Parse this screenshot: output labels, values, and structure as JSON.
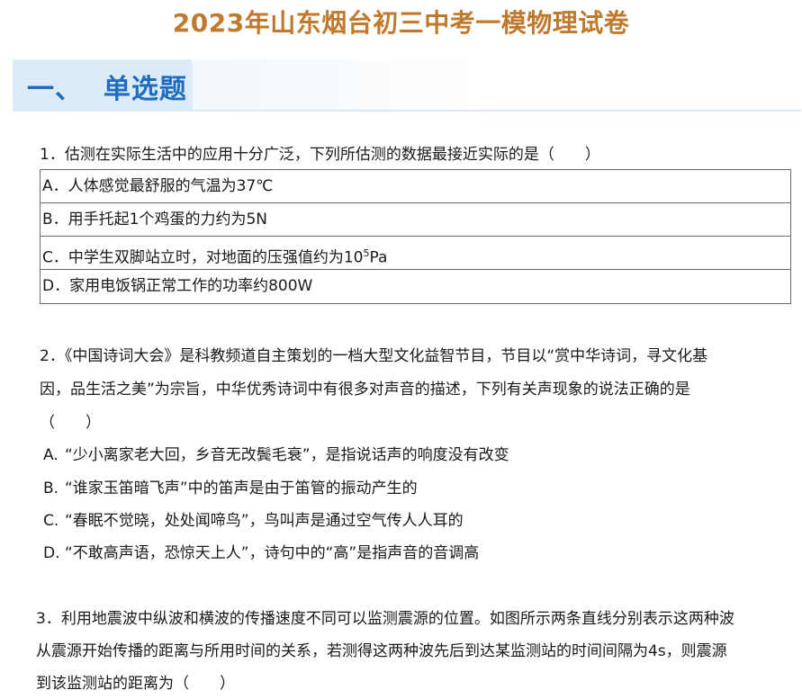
{
  "header": {
    "title": "2023年山东烟台初三中考一模物理试卷"
  },
  "section": {
    "title": "一、  单选题"
  },
  "q1": {
    "stem": "1．估测在实际生活中的应用十分广泛，下列所估测的数据最接近实际的是（　　）",
    "options": [
      {
        "text": "A．人体感觉最舒服的气温为37℃"
      },
      {
        "text": "B．用手托起1个鸡蛋的力约为5N"
      },
      {
        "prefix": "C．中学生双脚站立时，对地面的压强值约为10",
        "sup": "5",
        "suffix": "Pa"
      },
      {
        "text": "D．家用电饭锅正常工作的功率约800W"
      }
    ]
  },
  "q2": {
    "lines": [
      "2．《中国诗词大会》是科教频道自主策划的一档大型文化益智节目，节目以“赏中华诗词，寻文化基",
      "因，品生活之美”为宗旨，中华优秀诗词中有很多对声音的描述，下列有关声现象的说法正确的是",
      "（　　）"
    ],
    "options": [
      {
        "letter": "A.",
        "text": "“少小离家老大回，乡音无改鬓毛衰”，是指说话声的响度没有改变"
      },
      {
        "letter": "B.",
        "text": "“谁家玉笛暗飞声”中的笛声是由于笛管的振动产生的"
      },
      {
        "letter": "C.",
        "text": "“春眠不觉晓，处处闻啼鸟”，鸟叫声是通过空气传人人耳的"
      },
      {
        "letter": "D.",
        "text": "“不敢高声语，恐惊天上人”，诗句中的“高”是指声音的音调高"
      }
    ]
  },
  "q3": {
    "lines": [
      "3．利用地震波中纵波和横波的传播速度不同可以监测震源的位置。如图所示两条直线分别表示这两种波",
      "从震源开始传播的距离与所用时间的关系，若测得这两种波先后到达某监测站的时间间隔为4s，则震源",
      "到该监测站的距离为（　　）"
    ]
  }
}
